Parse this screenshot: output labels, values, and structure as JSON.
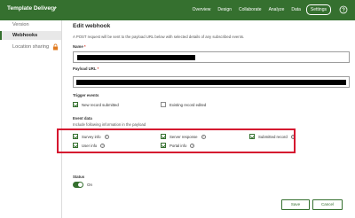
{
  "header": {
    "app_title": "Template Delivery",
    "nav": [
      "Overview",
      "Design",
      "Collaborate",
      "Analyze",
      "Data",
      "Settings"
    ],
    "active_nav": "Settings"
  },
  "sidebar": {
    "items": [
      {
        "label": "Version"
      },
      {
        "label": "Webhooks"
      },
      {
        "label": "Location sharing"
      }
    ]
  },
  "form": {
    "title": "Edit webhook",
    "description": "A POST request will be sent to the payload URL below with selected details of any subscribed events.",
    "name_label": "Name",
    "payload_label": "Payload URL",
    "required_marker": "*",
    "trigger_title": "Trigger events",
    "trigger_events": [
      {
        "label": "New record submitted",
        "checked": true
      },
      {
        "label": "Existing record edited",
        "checked": false
      }
    ],
    "event_data_title": "Event data",
    "event_data_desc": "Include following information in the payload",
    "event_data": [
      {
        "label": "Survey info",
        "checked": true,
        "info_icon": "info-icon"
      },
      {
        "label": "Server response",
        "checked": true,
        "info_icon": "info-icon"
      },
      {
        "label": "Submitted record",
        "checked": true,
        "info_icon": "info-icon"
      },
      {
        "label": "User info",
        "checked": true,
        "info_icon": "info-icon"
      },
      {
        "label": "Portal info",
        "checked": true,
        "info_icon": "info-icon"
      }
    ],
    "info_glyph": "?",
    "status_title": "Status",
    "status_value": "On",
    "status_on": true,
    "save_label": "Save",
    "cancel_label": "Cancel"
  },
  "colors": {
    "brand_green": "#35702f",
    "highlight_red": "#d5142f"
  }
}
